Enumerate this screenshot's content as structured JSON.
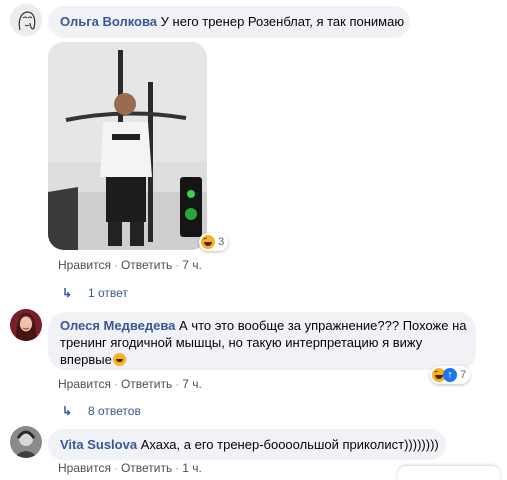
{
  "comments": [
    {
      "author": "Ольга Волкова",
      "text": "У него тренер Розенблат, я так понимаю",
      "photo_reaction_count": "3",
      "actions": {
        "like": "Нравится",
        "reply": "Ответить",
        "time": "7 ч."
      },
      "replies": "1 ответ"
    },
    {
      "author": "Олеся Медведева",
      "text_line1": "А что это вообще за упражнение??? Похоже на",
      "text_line2": "тренинг ягодичной мышцы, но такую интерпретацию я вижу",
      "text_line3": "впервые",
      "reaction_count": "7",
      "actions": {
        "like": "Нравится",
        "reply": "Ответить",
        "time": "7 ч."
      },
      "replies": "8 ответов"
    },
    {
      "author": "Vita Suslova",
      "text": "Ахаха, а его тренер-бооoольшой приколист))))))))",
      "actions": {
        "like": "Нравится",
        "reply": "Ответить",
        "time": "1 ч."
      }
    }
  ],
  "separator": "·",
  "reply_arrow": "↳",
  "colors": {
    "bubble": "#f0f2f5",
    "author": "#385898",
    "meta": "#606770"
  }
}
